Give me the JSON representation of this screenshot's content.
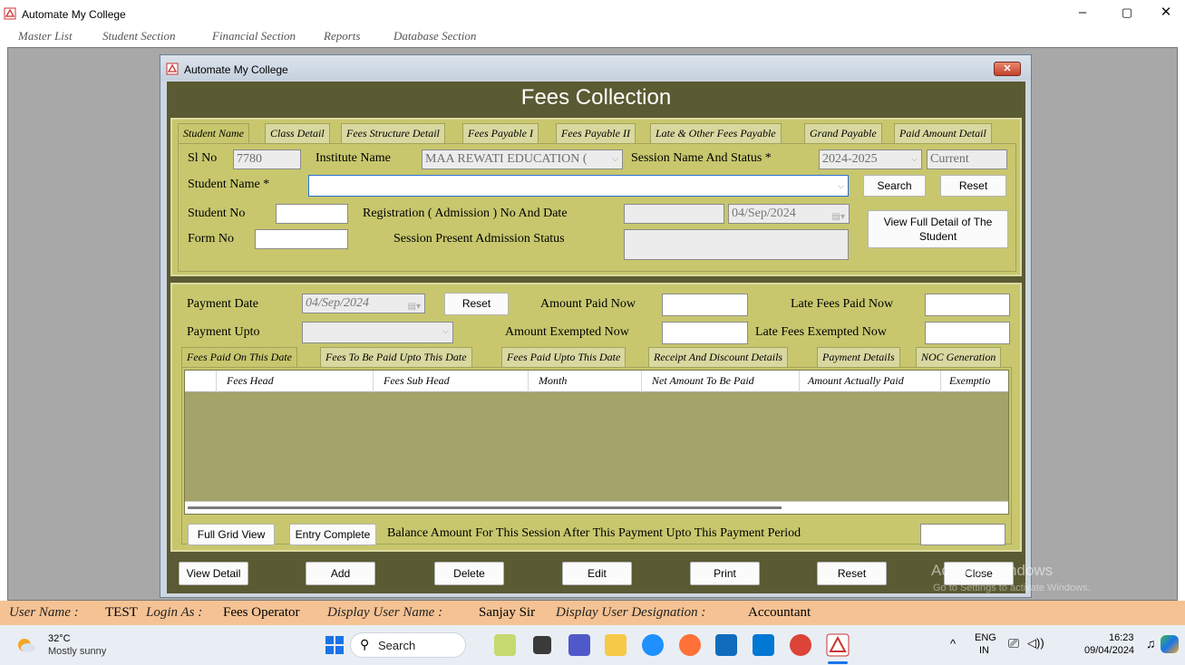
{
  "app": {
    "title": "Automate My College",
    "controls": {
      "minimize": "–",
      "maximize": "▢",
      "close": "✕"
    }
  },
  "menu": [
    "Master List",
    "Student Section",
    "Financial Section",
    "Reports",
    "Database Section"
  ],
  "inner_window": {
    "title": "Automate My College",
    "close": "✕"
  },
  "form": {
    "title": "Fees Collection",
    "top_tabs": [
      "Student Name",
      "Class Detail",
      "Fees Structure Detail",
      "Fees Payable I",
      "Fees Payable II",
      "Late & Other Fees Payable",
      "Grand Payable",
      "Paid Amount Detail"
    ],
    "sl_no": {
      "label": "Sl No",
      "value": "7780"
    },
    "institute": {
      "label": "Institute Name",
      "value": "MAA REWATI EDUCATION ("
    },
    "session": {
      "label": "Session Name And Status *",
      "value": "2024-2025",
      "status": "Current"
    },
    "student_name": {
      "label": "Student Name *",
      "value": ""
    },
    "search_label": "Search",
    "reset_label": "Reset",
    "student_no": {
      "label": "Student No",
      "value": ""
    },
    "registration": {
      "label": "Registration ( Admission ) No And Date",
      "value": "",
      "date": "04/Sep/2024"
    },
    "view_full_label": "View Full Detail of The Student",
    "form_no": {
      "label": "Form No",
      "value": ""
    },
    "admission_status": {
      "label": "Session Present Admission Status",
      "value": ""
    },
    "payment_date": {
      "label": "Payment Date",
      "value": "04/Sep/2024"
    },
    "payment_reset_label": "Reset",
    "amount_paid_now": {
      "label": "Amount Paid Now",
      "value": ""
    },
    "late_fees_paid_now": {
      "label": "Late Fees Paid Now",
      "value": ""
    },
    "payment_upto": {
      "label": "Payment Upto",
      "value": ""
    },
    "amount_exempted_now": {
      "label": "Amount Exempted Now",
      "value": ""
    },
    "late_fees_exempted_now": {
      "label": "Late Fees Exempted Now",
      "value": ""
    },
    "grid_tabs": [
      "Fees Paid On This Date",
      "Fees To Be Paid Upto This Date",
      "Fees Paid Upto This Date",
      "Receipt And Discount Details",
      "Payment Details",
      "NOC Generation"
    ],
    "grid_columns": [
      "Fees Head",
      "Fees Sub Head",
      "Month",
      "Net Amount To Be Paid",
      "Amount Actually Paid",
      "Exemptio"
    ],
    "full_grid_label": "Full Grid View",
    "entry_complete_label": "Entry Complete",
    "balance": {
      "label": "Balance Amount For This Session After This Payment Upto This Payment Period",
      "value": ""
    },
    "bottom_buttons": [
      "View Detail",
      "Add",
      "Delete",
      "Edit",
      "Print",
      "Reset",
      "Close"
    ]
  },
  "watermark": {
    "line1": "Activate Windows",
    "line2": "Go to Settings to activate Windows."
  },
  "user_bar": {
    "user_name_label": "User Name :",
    "user_name": "TEST",
    "login_as_label": "Login As :",
    "login_as": "Fees Operator",
    "display_name_label": "Display User Name :",
    "display_name": "Sanjay Sir",
    "designation_label": "Display User Designation :",
    "designation": "Accountant"
  },
  "taskbar": {
    "weather_temp": "32°C",
    "weather_text": "Mostly sunny",
    "search_placeholder": "Search",
    "lang_1": "ENG",
    "lang_2": "IN",
    "time": "16:23",
    "date": "09/04/2024",
    "colors": {
      "windows": "#1a73e8",
      "edge": "#1e90ff",
      "firefox": "#ff7139",
      "teams": "#5059c9",
      "explorer": "#f7c948",
      "store": "#0f6cbd",
      "mail": "#0078d4",
      "chrome": "#db4437"
    }
  }
}
